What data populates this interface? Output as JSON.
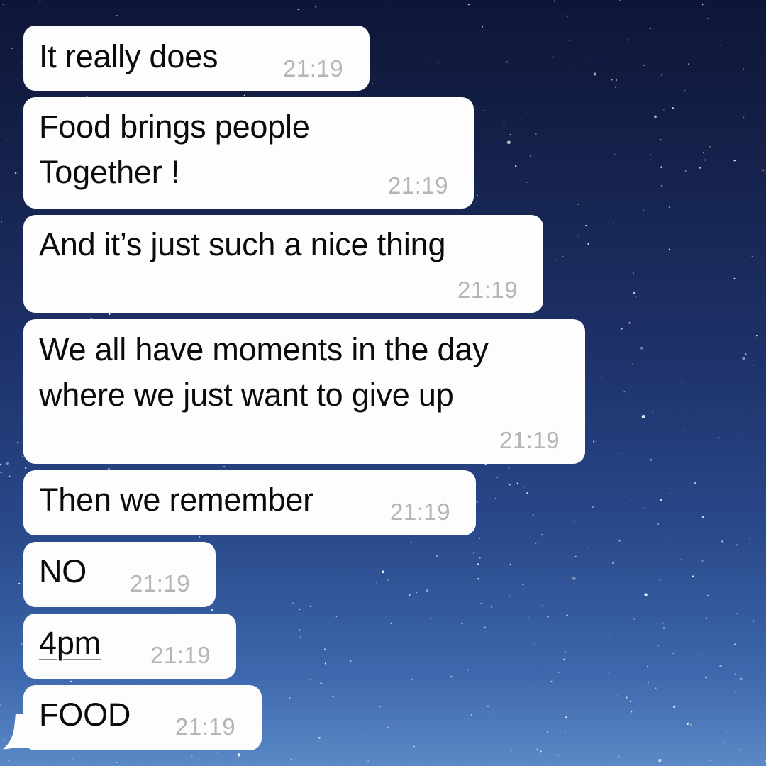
{
  "messages": [
    {
      "text": "It really does",
      "time": "21:19"
    },
    {
      "text_lines": [
        "Food brings people",
        "Together !"
      ],
      "time": "21:19"
    },
    {
      "text": "And it’s just such a nice thing",
      "time": "21:19"
    },
    {
      "text_lines": [
        "We all have moments in the day",
        "where we just want to give up"
      ],
      "time": "21:19"
    },
    {
      "text": "Then we remember",
      "time": "21:19"
    },
    {
      "text": "NO",
      "time": "21:19"
    },
    {
      "text": "4pm",
      "time": "21:19",
      "is_link": true
    },
    {
      "text": "FOOD",
      "time": "21:19"
    }
  ],
  "colors": {
    "bubble": "#fdfdfd",
    "text": "#0b0b0b",
    "timestamp": "#b5b5b5",
    "background_top": "#0e1638",
    "background_bottom": "#5b89c6"
  },
  "background": "starry-night-sky"
}
